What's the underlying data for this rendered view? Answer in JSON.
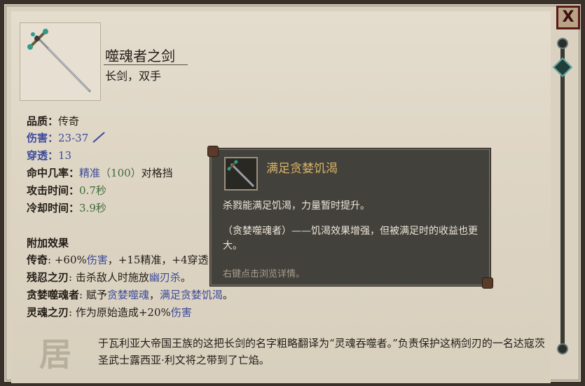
{
  "window": {
    "close_label": "X"
  },
  "item": {
    "name": "噬魂者之剑",
    "subtitle": "长剑，双手"
  },
  "stats": [
    {
      "label": "品质：",
      "value": "传奇"
    },
    {
      "label": "伤害：",
      "value": "23-37"
    },
    {
      "label": "穿透：",
      "value": "13"
    },
    {
      "label": "命中几率：",
      "value_a": "精准",
      "value_b": "（100）",
      "value_c": "对格挡"
    },
    {
      "label": "攻击时间：",
      "value": "0.7秒"
    },
    {
      "label": "冷却时间：",
      "value": "3.9秒"
    }
  ],
  "effects_heading": "附加效果",
  "effects": [
    {
      "label": "传奇",
      "colon": ": ",
      "p1": "+60%",
      "p2": "伤害",
      "p3": "，+15精准，+4穿透"
    },
    {
      "label": "残忍之刃",
      "colon": ": ",
      "p1": "击杀敌人时施放",
      "p2": "幽刃杀",
      "p3": "。"
    },
    {
      "label": "贪婪噬魂者",
      "colon": ": ",
      "p1": "赋予",
      "p2": "贪婪噬魂",
      "p3": "，",
      "p4": "满足贪婪饥渴",
      "p5": "。"
    },
    {
      "label": "灵魂之刃",
      "colon": ": ",
      "p1": "作为原始造成+20%",
      "p2": "伤害"
    }
  ],
  "description": "于瓦利亚大帝国王族的这把长剑的名字粗略翻译为“灵魂吞噬者。”负责保护这柄剑刃的一名达寇茨圣武士露西亚·利文将之带到了亡焰。",
  "emblem_glyph": "居",
  "tooltip": {
    "title": "满足贪婪饥渴",
    "line1": "杀戮能满足饥渴，力量暂时提升。",
    "line2": "（贪婪噬魂者）——饥渴效果增强，但被满足时的收益也更大。",
    "hint": "右键点击浏览详情。"
  },
  "colors": {
    "keyword_blue": "#3b4a9a",
    "accuracy_green": "#3f6b3a",
    "tooltip_title": "#d8b36a"
  }
}
